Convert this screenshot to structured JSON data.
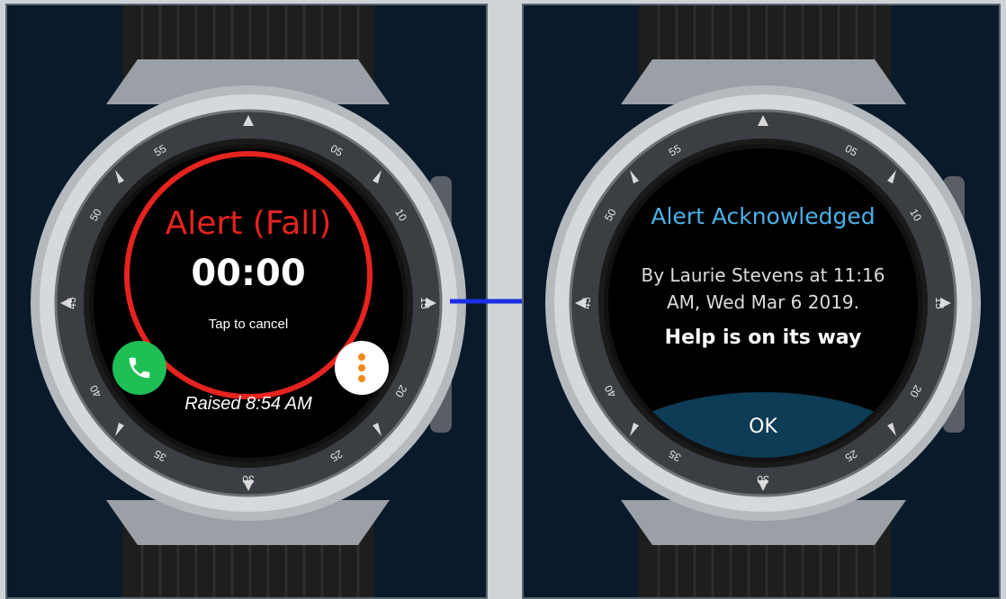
{
  "left_screen": {
    "alert_title": "Alert (Fall)",
    "timer": "00:00",
    "cancel_hint": "Tap to cancel",
    "raised_text": "Raised 8:54 AM",
    "call_icon": "phone-icon",
    "more_icon": "more-vertical-icon"
  },
  "right_screen": {
    "title": "Alert Acknowledged",
    "line1": "By Laurie Stevens at 11:16",
    "line2": "AM, Wed Mar  6 2019.",
    "help_text": "Help is on its way",
    "ok_label": "OK"
  },
  "bezel_numbers": [
    "55",
    "05",
    "10",
    "15",
    "20",
    "25",
    "30",
    "35",
    "40",
    "45",
    "50"
  ],
  "colors": {
    "alert_red": "#e5231f",
    "ack_blue": "#4ab1e6",
    "call_green": "#1fbf55",
    "more_orange": "#f08a1c",
    "ok_button_bg": "#0e3b55",
    "arrow_blue": "#1a2ee6",
    "background": "#0a1a2a"
  }
}
